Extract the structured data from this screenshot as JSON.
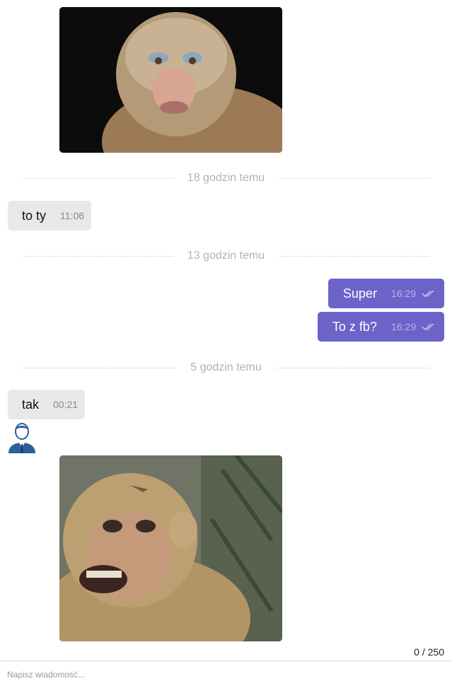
{
  "messages": [
    {
      "type": "image",
      "direction": "incoming",
      "subject": "monkey photo"
    },
    {
      "type": "divider",
      "label": "18 godzin temu"
    },
    {
      "type": "text",
      "direction": "incoming",
      "text": "to ty",
      "time": "11:06"
    },
    {
      "type": "divider",
      "label": "13 godzin temu"
    },
    {
      "type": "text",
      "direction": "outgoing",
      "text": "Super",
      "time": "16:29",
      "status_icon": "double-check-icon"
    },
    {
      "type": "text",
      "direction": "outgoing",
      "text": "To z fb?",
      "time": "16:29",
      "status_icon": "double-check-icon"
    },
    {
      "type": "divider",
      "label": "5 godzin temu"
    },
    {
      "type": "text",
      "direction": "incoming",
      "text": "tak",
      "time": "00:21"
    },
    {
      "type": "avatar",
      "icon": "user-avatar-icon"
    },
    {
      "type": "image",
      "direction": "incoming",
      "subject": "smiling monkey photo"
    }
  ],
  "composer": {
    "char_counter": "0 / 250",
    "placeholder": "Napisz wiadomość..."
  },
  "colors": {
    "outgoing_bubble": "#6c63c9",
    "incoming_bubble": "#e8e8e8",
    "divider_text": "#b2b2b2"
  }
}
